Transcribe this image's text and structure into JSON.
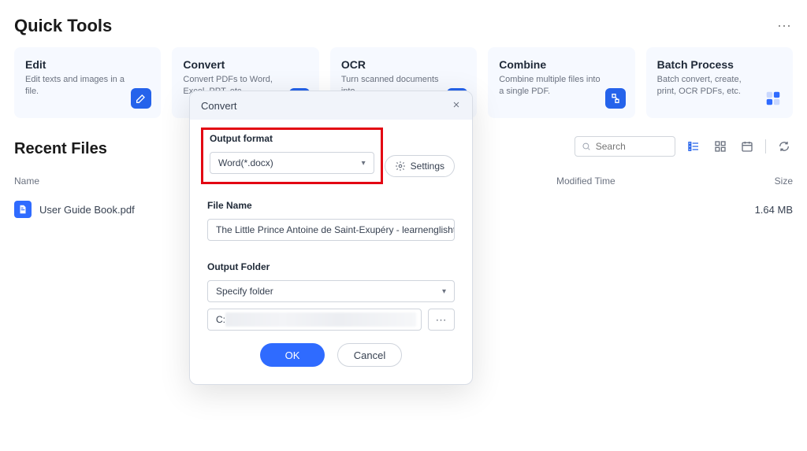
{
  "header": {
    "title": "Quick Tools"
  },
  "tools": [
    {
      "title": "Edit",
      "desc": "Edit texts and images in a file.",
      "icon": "pencil"
    },
    {
      "title": "Convert",
      "desc": "Convert PDFs to Word, Excel, PPT, etc.",
      "icon": "arrows"
    },
    {
      "title": "OCR",
      "desc": "Turn scanned documents into",
      "icon": "ocr"
    },
    {
      "title": "Combine",
      "desc": "Combine multiple files into a single PDF.",
      "icon": "merge"
    },
    {
      "title": "Batch Process",
      "desc": "Batch convert, create, print, OCR PDFs, etc.",
      "icon": "batch"
    }
  ],
  "recent": {
    "title": "Recent Files",
    "search_placeholder": "Search",
    "columns": {
      "name": "Name",
      "time": "Modified Time",
      "size": "Size"
    },
    "files": [
      {
        "name": "User Guide Book.pdf",
        "time": "",
        "size": "1.64 MB"
      }
    ]
  },
  "dialog": {
    "title": "Convert",
    "output_format_label": "Output format",
    "output_format_value": "Word(*.docx)",
    "settings_label": "Settings",
    "file_name_label": "File Name",
    "file_name_value": "The Little Prince Antoine de Saint-Exupéry - learnenglishteam.do",
    "output_folder_label": "Output Folder",
    "output_folder_select": "Specify folder",
    "output_folder_path_prefix": "C:",
    "ok_label": "OK",
    "cancel_label": "Cancel"
  }
}
